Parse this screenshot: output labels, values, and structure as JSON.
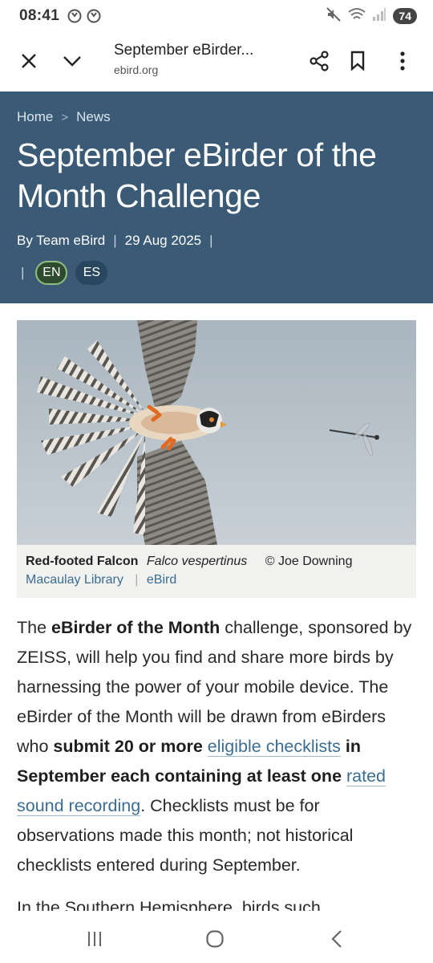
{
  "status_bar": {
    "time": "08:41",
    "battery": "74",
    "icons": [
      "sync-icon",
      "sync-icon",
      "mute-icon",
      "wifi-icon",
      "signal-icon"
    ]
  },
  "toolbar": {
    "page_title": "September eBirder...",
    "url": "ebird.org",
    "icons": [
      "close-icon",
      "chevron-down-icon",
      "share-icon",
      "bookmark-icon",
      "more-vert-icon"
    ]
  },
  "hero": {
    "background": "#3a5a76",
    "breadcrumb": {
      "home": "Home",
      "separator": ">",
      "current": "News"
    },
    "title": "September eBirder of the Month Challenge",
    "byline": "By Team eBird",
    "date": "29 Aug 2025",
    "separator": "|",
    "languages": [
      "EN",
      "ES"
    ],
    "active_language": "EN"
  },
  "figure": {
    "caption": {
      "common_name": "Red-footed Falcon",
      "scientific_name": "Falco vespertinus",
      "credit": "© Joe Downing",
      "source": "Macaulay Library",
      "source_separator": "|",
      "link": "eBird"
    }
  },
  "article": {
    "p1": {
      "t1": "The ",
      "b1": "eBirder of the Month",
      "t2": " challenge, sponsored by ZEISS, will help you find and share more birds by harnessing the power of your mobile device. The eBirder of the Month will be drawn from eBirders who ",
      "b2": "submit 20 or more ",
      "link1": "eligible checklists",
      "b3": " in September each containing at least one ",
      "link2": "rated sound recording",
      "t3": ". Checklists must be for observations made this month; not historical checklists entered during September."
    },
    "p2": "In the Southern Hemisphere, birds such"
  },
  "nav_bar": {
    "icons": [
      "recent-apps-icon",
      "home-icon",
      "back-icon"
    ]
  },
  "colors": {
    "link": "#3b6d92",
    "hero": "#3a5a76",
    "active_lang_border": "#8ebf7d"
  }
}
